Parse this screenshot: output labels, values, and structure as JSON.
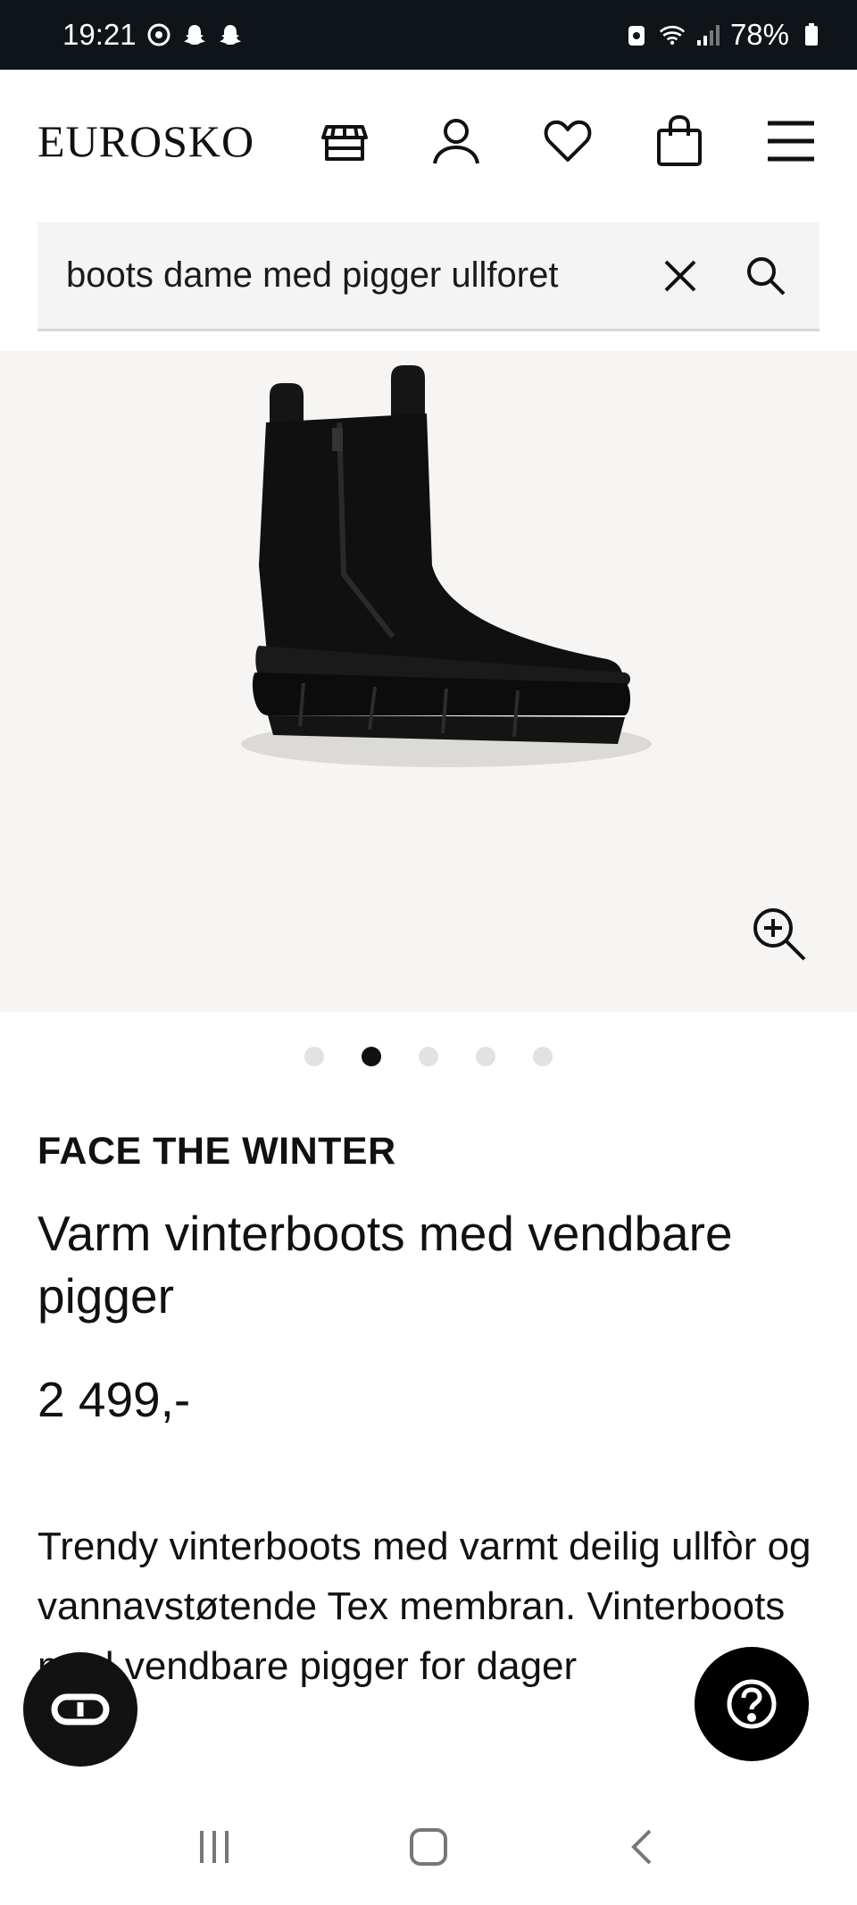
{
  "status": {
    "time": "19:21",
    "battery": "78%"
  },
  "header": {
    "logo": "EUROSKO",
    "icons": [
      "store-icon",
      "account-icon",
      "wishlist-heart-icon",
      "shopping-bag-icon",
      "menu-icon"
    ]
  },
  "search": {
    "value": "boots dame med pigger ullforet"
  },
  "gallery": {
    "image_count": 5,
    "active_index": 1
  },
  "product": {
    "brand": "FACE THE WINTER",
    "title": "Varm vinterboots med vendbare pigger",
    "price": "2 499,-",
    "description": "Trendy vinterboots med varmt deilig ullfòr og vannavstøtende Tex membran. Vinterboots med vendbare pigger for dager"
  },
  "colors": {
    "statusbar": "#0f1419",
    "hero_bg": "#f6f5f3",
    "search_bg": "#f4f4f4",
    "dot_active": "#111111",
    "dot_inactive": "#e2e2e2"
  }
}
